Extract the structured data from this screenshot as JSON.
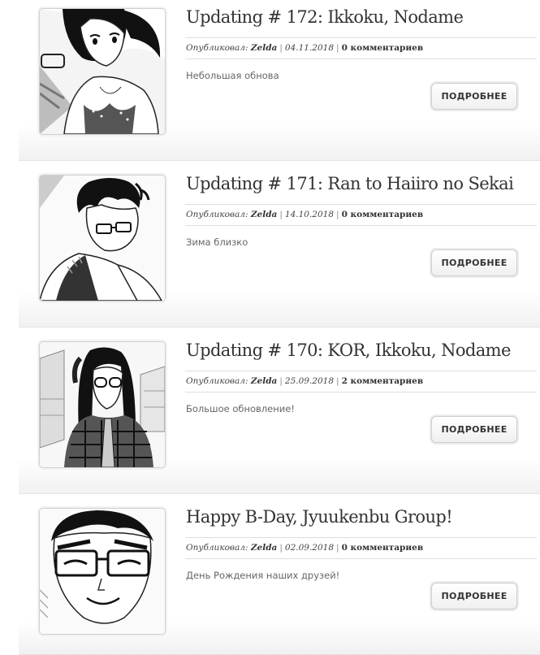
{
  "posts": [
    {
      "title": "Updating # 172: Ikkoku, Nodame",
      "meta_label": "Опубликовал:",
      "author": "Zelda",
      "date": "04.11.2018",
      "comments": "0 комментариев",
      "excerpt": "Небольшая обнова",
      "button": "ПОДРОБНЕЕ",
      "thumb_icon": "manga-girl-bikini-thumbnail"
    },
    {
      "title": "Updating # 171: Ran to Haiiro no Sekai",
      "meta_label": "Опубликовал:",
      "author": "Zelda",
      "date": "14.10.2018",
      "comments": "0 комментариев",
      "excerpt": "Зима близко",
      "button": "ПОДРОБНЕЕ",
      "thumb_icon": "manga-man-glasses-coat-thumbnail"
    },
    {
      "title": "Updating # 170: KOR, Ikkoku, Nodame",
      "meta_label": "Опубликовал:",
      "author": "Zelda",
      "date": "25.09.2018",
      "comments": "2 комментариев",
      "excerpt": "Большое обновление!",
      "button": "ПОДРОБНЕЕ",
      "thumb_icon": "manga-girl-glasses-plaid-thumbnail"
    },
    {
      "title": "Happy B-Day, Jyuukenbu Group!",
      "meta_label": "Опубликовал:",
      "author": "Zelda",
      "date": "02.09.2018",
      "comments": "0 комментариев",
      "excerpt": "День Рождения наших друзей!",
      "button": "ПОДРОБНЕЕ",
      "thumb_icon": "manga-man-glasses-smile-thumbnail"
    }
  ]
}
